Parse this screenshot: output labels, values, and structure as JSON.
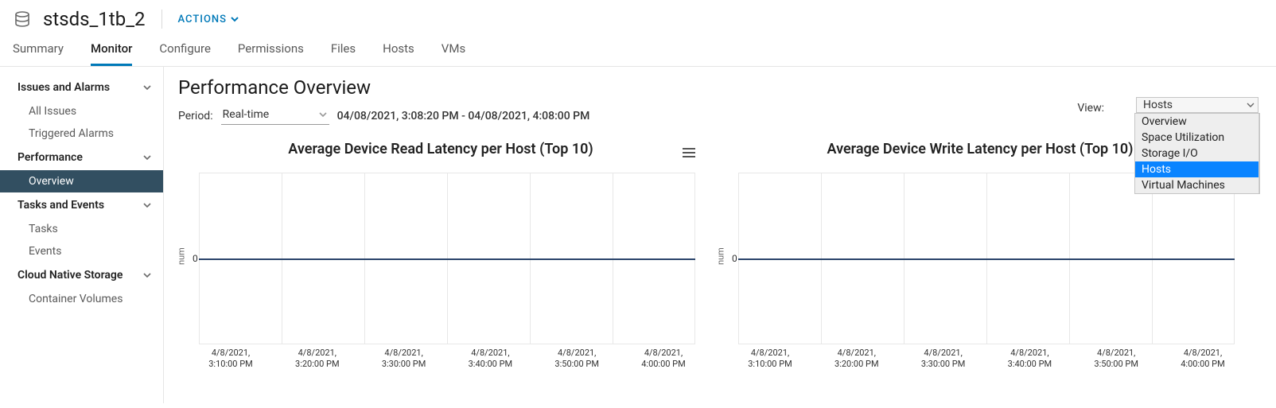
{
  "header": {
    "title": "stsds_1tb_2",
    "actions_label": "ACTIONS"
  },
  "tabs": [
    "Summary",
    "Monitor",
    "Configure",
    "Permissions",
    "Files",
    "Hosts",
    "VMs"
  ],
  "active_tab_index": 1,
  "sidebar": {
    "groups": [
      {
        "label": "Issues and Alarms",
        "items": [
          "All Issues",
          "Triggered Alarms"
        ]
      },
      {
        "label": "Performance",
        "items": [
          "Overview"
        ],
        "active_item_index": 0
      },
      {
        "label": "Tasks and Events",
        "items": [
          "Tasks",
          "Events"
        ]
      },
      {
        "label": "Cloud Native Storage",
        "items": [
          "Container Volumes"
        ]
      }
    ]
  },
  "page": {
    "title": "Performance Overview",
    "period_label": "Period:",
    "period_value": "Real-time",
    "range_text": "04/08/2021, 3:08:20 PM - 04/08/2021, 4:08:00 PM",
    "view_label": "View:",
    "view_selected": "Hosts",
    "view_options": [
      "Overview",
      "Space Utilization",
      "Storage I/O",
      "Hosts",
      "Virtual Machines"
    ]
  },
  "chart_data": [
    {
      "type": "line",
      "title": "Average Device Read Latency per Host (Top 10)",
      "ylabel": "num",
      "ylim": [
        0,
        0
      ],
      "y_ticks": [
        0
      ],
      "categories": [
        "4/8/2021, 3:10:00 PM",
        "4/8/2021, 3:20:00 PM",
        "4/8/2021, 3:30:00 PM",
        "4/8/2021, 3:40:00 PM",
        "4/8/2021, 3:50:00 PM",
        "4/8/2021, 4:00:00 PM"
      ],
      "values": [
        0,
        0,
        0,
        0,
        0,
        0
      ]
    },
    {
      "type": "line",
      "title": "Average Device Write Latency per Host (Top 10)",
      "ylabel": "num",
      "ylim": [
        0,
        0
      ],
      "y_ticks": [
        0
      ],
      "categories": [
        "4/8/2021, 3:10:00 PM",
        "4/8/2021, 3:20:00 PM",
        "4/8/2021, 3:30:00 PM",
        "4/8/2021, 3:40:00 PM",
        "4/8/2021, 3:50:00 PM",
        "4/8/2021, 4:00:00 PM"
      ],
      "values": [
        0,
        0,
        0,
        0,
        0,
        0
      ]
    }
  ]
}
